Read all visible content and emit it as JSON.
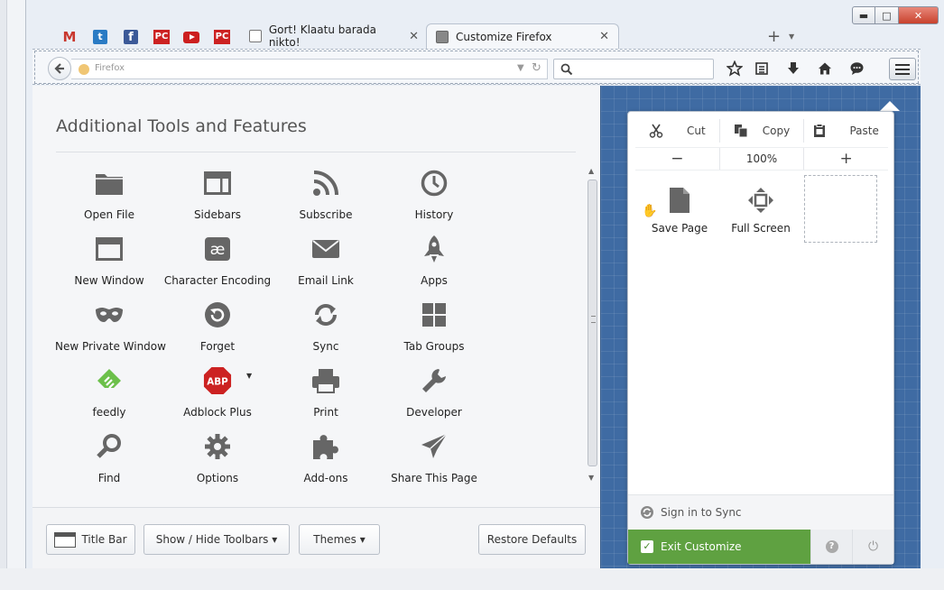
{
  "window": {
    "minimize_label": "▬",
    "maximize_label": "□",
    "close_label": "✕"
  },
  "tabs": {
    "pinned": [
      "M",
      "t",
      "f",
      "PC",
      "",
      "PC"
    ],
    "background_tab": {
      "title": "Gort! Klaatu barada nikto!",
      "close": "✕"
    },
    "active_tab": {
      "title": "Customize Firefox",
      "close": "✕"
    },
    "new_tab": "+",
    "list_tabs": "▼"
  },
  "navbar": {
    "back": "◄",
    "url_placeholder": "Firefox",
    "url_dropdown": "▼",
    "reload": "↻",
    "search_placeholder": "",
    "search_icon": "⚲",
    "bookmark": "☆",
    "reader": "☰",
    "download": "⬇",
    "home": "⌂",
    "chat": "☻"
  },
  "palette": {
    "title": "Additional Tools and Features",
    "items": [
      {
        "label": "Open File",
        "icon": "folder-icon"
      },
      {
        "label": "Sidebars",
        "icon": "sidebar-icon"
      },
      {
        "label": "Subscribe",
        "icon": "rss-icon"
      },
      {
        "label": "History",
        "icon": "clock-icon"
      },
      {
        "label": "New Window",
        "icon": "window-icon"
      },
      {
        "label": "Character Encoding",
        "icon": "encoding-icon"
      },
      {
        "label": "Email Link",
        "icon": "envelope-icon"
      },
      {
        "label": "Apps",
        "icon": "rocket-icon"
      },
      {
        "label": "New Private Window",
        "icon": "mask-icon"
      },
      {
        "label": "Forget",
        "icon": "forget-icon"
      },
      {
        "label": "Sync",
        "icon": "sync-icon"
      },
      {
        "label": "Tab Groups",
        "icon": "tab-groups-icon"
      },
      {
        "label": "feedly",
        "icon": "feedly-icon"
      },
      {
        "label": "Adblock Plus",
        "icon": "abp-icon"
      },
      {
        "label": "Print",
        "icon": "printer-icon"
      },
      {
        "label": "Developer",
        "icon": "wrench-icon"
      },
      {
        "label": "Find",
        "icon": "magnifier-icon"
      },
      {
        "label": "Options",
        "icon": "gear-icon"
      },
      {
        "label": "Add-ons",
        "icon": "puzzle-icon"
      },
      {
        "label": "Share This Page",
        "icon": "share-icon"
      }
    ],
    "encoding_glyph": "æ",
    "abp_text": "ABP",
    "abp_dropdown": "▼"
  },
  "footer": {
    "title_bar": "Title Bar",
    "show_hide_toolbars": "Show / Hide Toolbars ▾",
    "themes": "Themes ▾",
    "restore_defaults": "Restore Defaults"
  },
  "panel": {
    "cut": "Cut",
    "copy": "Copy",
    "paste": "Paste",
    "zoom_out": "−",
    "zoom_level": "100%",
    "zoom_in": "+",
    "items": [
      {
        "label": "Save Page",
        "icon": "page-icon"
      },
      {
        "label": "Full Screen",
        "icon": "fullscreen-icon"
      }
    ],
    "sign_in_sync": "Sign in to Sync",
    "exit_customize": "Exit Customize",
    "check": "✓",
    "help": "?",
    "quit": "⏻"
  },
  "colors": {
    "customize_bg": "#3f6ba3",
    "exit_green": "#5fa141",
    "abp_red": "#cc2222",
    "feedly_green": "#6cc04a",
    "icon_gray": "#666666"
  }
}
